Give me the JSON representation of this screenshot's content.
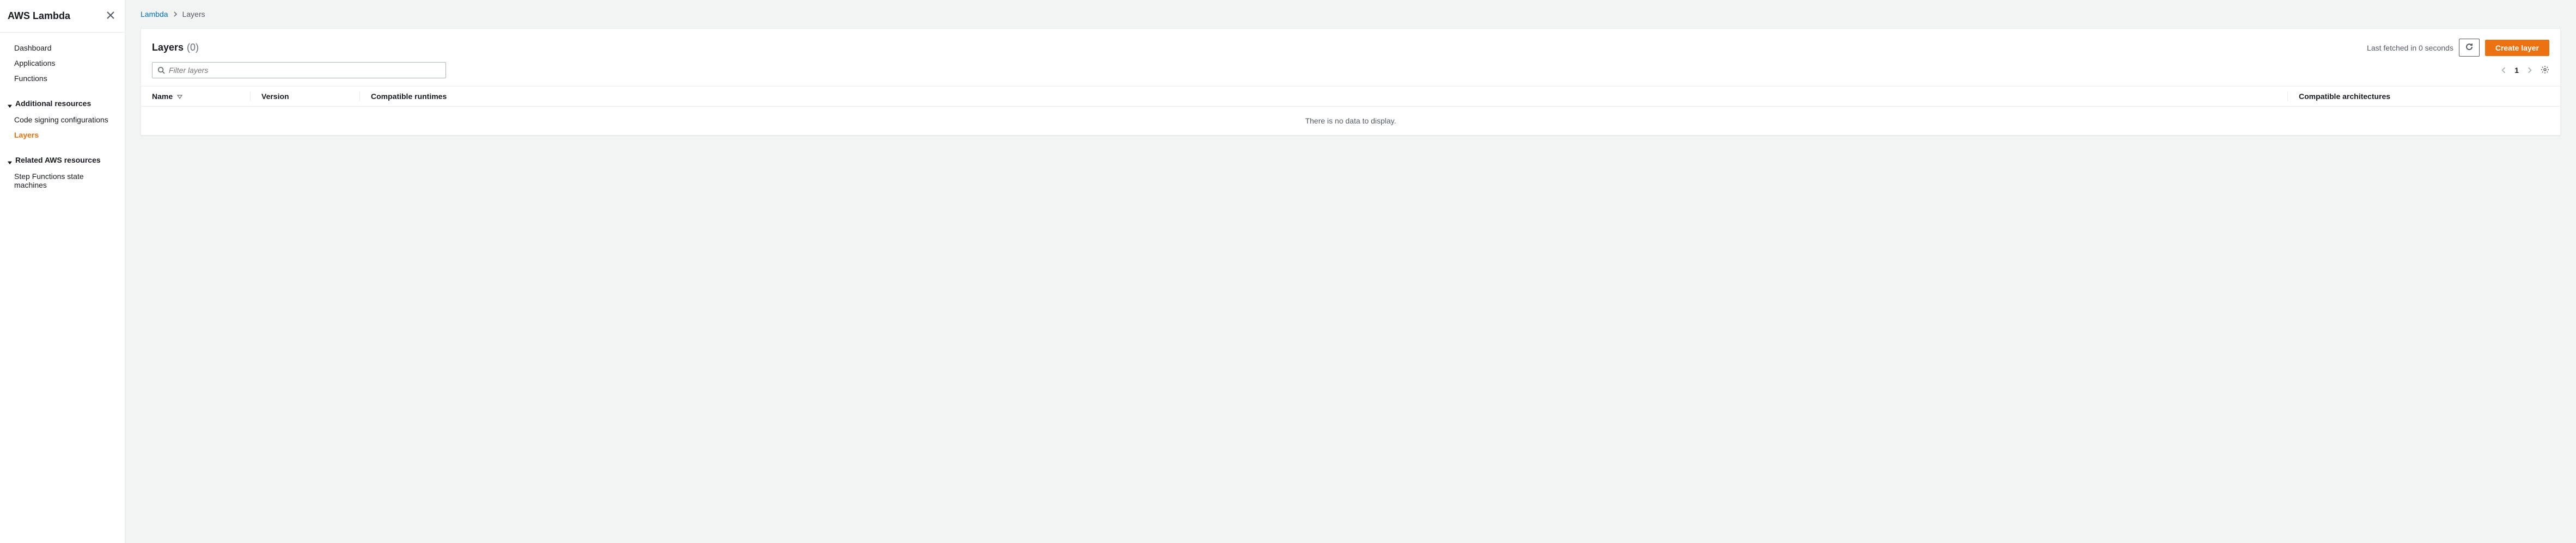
{
  "sidebar": {
    "title": "AWS Lambda",
    "nav_top": [
      {
        "label": "Dashboard"
      },
      {
        "label": "Applications"
      },
      {
        "label": "Functions"
      }
    ],
    "sections": [
      {
        "title": "Additional resources",
        "items": [
          {
            "label": "Code signing configurations",
            "active": false
          },
          {
            "label": "Layers",
            "active": true
          }
        ]
      },
      {
        "title": "Related AWS resources",
        "items": [
          {
            "label": "Step Functions state machines",
            "active": false
          }
        ]
      }
    ]
  },
  "breadcrumb": {
    "root": "Lambda",
    "current": "Layers"
  },
  "panel": {
    "title": "Layers",
    "count": "(0)",
    "last_fetched": "Last fetched in 0 seconds",
    "create_label": "Create layer",
    "search_placeholder": "Filter layers",
    "page": "1",
    "columns": {
      "name": "Name",
      "version": "Version",
      "runtimes": "Compatible runtimes",
      "architectures": "Compatible architectures"
    },
    "empty": "There is no data to display."
  }
}
